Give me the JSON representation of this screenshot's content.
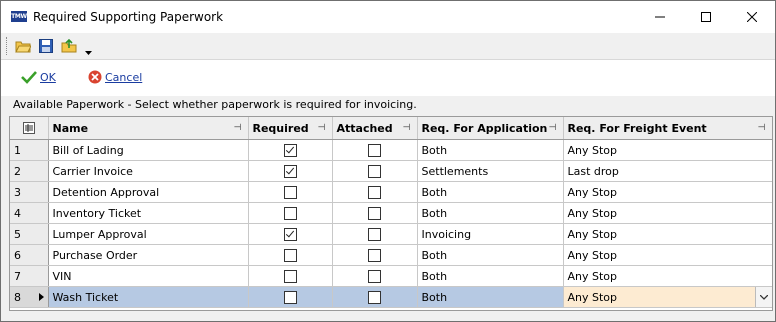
{
  "window": {
    "title": "Required Supporting Paperwork",
    "app_icon_text": "TMW"
  },
  "toolbar": {
    "buttons": [
      "open-folder-icon",
      "save-icon",
      "export-icon"
    ],
    "overflow_icon": "chevron-down-icon"
  },
  "actions": {
    "ok_label": "OK",
    "cancel_label": "Cancel"
  },
  "section": {
    "caption": "Available Paperwork  -  Select whether paperwork is required for invoicing."
  },
  "grid": {
    "columns": {
      "name": "Name",
      "required": "Required",
      "attached": "Attached",
      "req_application": "Req. For Application",
      "req_freight_event": "Req. For Freight Event"
    },
    "rows": [
      {
        "num": "1",
        "name": "Bill of Lading",
        "required": true,
        "attached": false,
        "application": "Both",
        "freight_event": "Any Stop"
      },
      {
        "num": "2",
        "name": "Carrier Invoice",
        "required": true,
        "attached": false,
        "application": "Settlements",
        "freight_event": "Last drop"
      },
      {
        "num": "3",
        "name": "Detention Approval",
        "required": false,
        "attached": false,
        "application": "Both",
        "freight_event": "Any Stop"
      },
      {
        "num": "4",
        "name": "Inventory Ticket",
        "required": false,
        "attached": false,
        "application": "Both",
        "freight_event": "Any Stop"
      },
      {
        "num": "5",
        "name": "Lumper Approval",
        "required": true,
        "attached": false,
        "application": "Invoicing",
        "freight_event": "Any Stop"
      },
      {
        "num": "6",
        "name": "Purchase Order",
        "required": false,
        "attached": false,
        "application": "Both",
        "freight_event": "Any Stop"
      },
      {
        "num": "7",
        "name": "VIN",
        "required": false,
        "attached": false,
        "application": "Both",
        "freight_event": "Any Stop"
      },
      {
        "num": "8",
        "name": "Wash Ticket",
        "required": false,
        "attached": false,
        "application": "Both",
        "freight_event": "Any Stop",
        "selected": true
      }
    ]
  },
  "colors": {
    "selected_row": "#b6c9e3",
    "editing_cell": "#fdebd2",
    "link": "#1a3ca0",
    "ok_check": "#3aa02a",
    "cancel_icon": "#d9432f"
  }
}
